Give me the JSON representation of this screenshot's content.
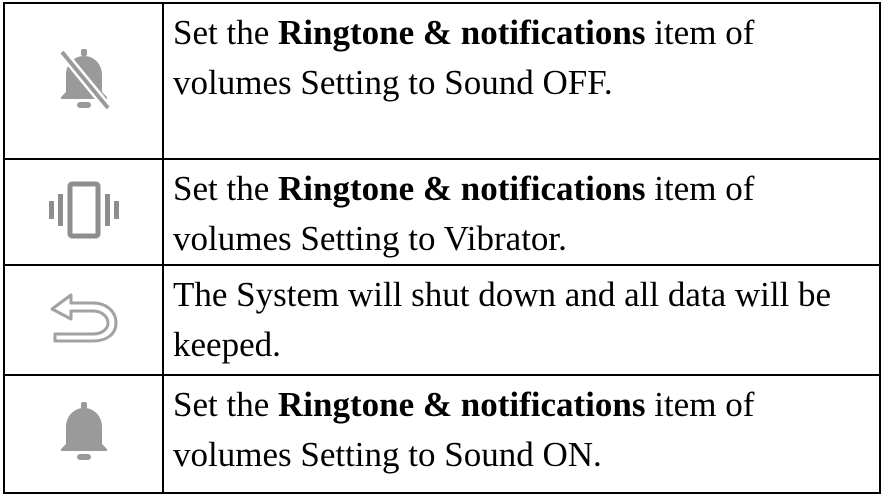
{
  "rows": [
    {
      "icon": "bell-off-icon",
      "prefix": "Set the ",
      "bold": "Ringtone & notifications",
      "suffix": " item of volumes Setting to Sound OFF."
    },
    {
      "icon": "vibrate-icon",
      "prefix": "Set the ",
      "bold": "Ringtone & notifications",
      "suffix": " item of volumes Setting to Vibrator."
    },
    {
      "icon": "back-icon",
      "prefix": "The System will shut down and all data will be keeped.",
      "bold": "",
      "suffix": ""
    },
    {
      "icon": "bell-icon",
      "prefix": "Set the ",
      "bold": "Ringtone & notifications",
      "suffix": " item of volumes Setting to Sound ON."
    }
  ],
  "colors": {
    "icon_gray": "#9a9a9a",
    "border": "#000000",
    "text": "#000000"
  }
}
